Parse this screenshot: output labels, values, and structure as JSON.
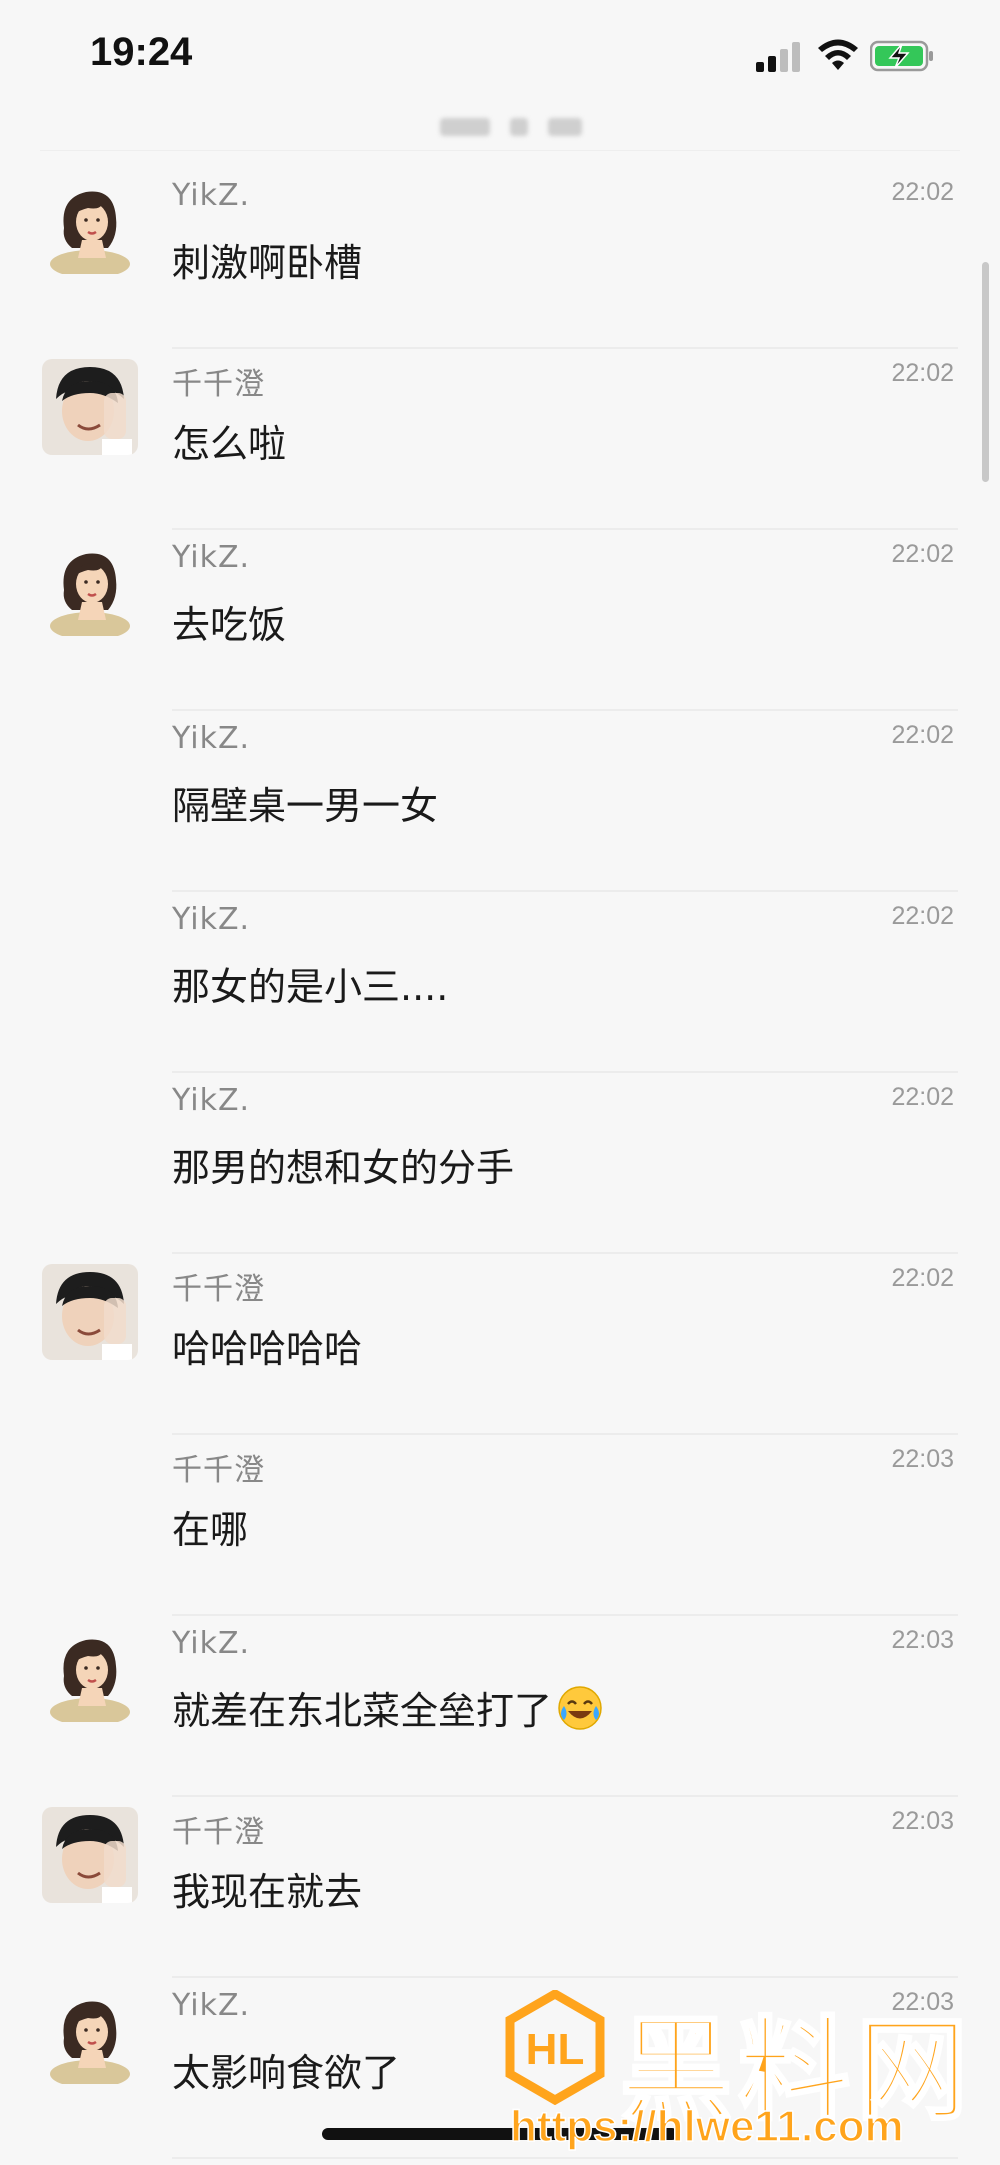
{
  "status_bar": {
    "time": "19:24",
    "icons": [
      "signal-icon",
      "wifi-icon",
      "battery-charging-icon"
    ]
  },
  "messages": [
    {
      "sender": "YikZ.",
      "time": "22:02",
      "text": "刺激啊卧槽",
      "avatar": "belle"
    },
    {
      "sender": "千千澄",
      "time": "22:02",
      "text": "怎么啦",
      "avatar": "guy"
    },
    {
      "sender": "YikZ.",
      "time": "22:02",
      "text": "去吃饭",
      "avatar": "belle"
    },
    {
      "sender": "YikZ.",
      "time": "22:02",
      "text": "隔壁桌一男一女",
      "avatar": ""
    },
    {
      "sender": "YikZ.",
      "time": "22:02",
      "text": "那女的是小三....",
      "avatar": ""
    },
    {
      "sender": "YikZ.",
      "time": "22:02",
      "text": "那男的想和女的分手",
      "avatar": ""
    },
    {
      "sender": "千千澄",
      "time": "22:02",
      "text": "哈哈哈哈哈",
      "avatar": "guy"
    },
    {
      "sender": "千千澄",
      "time": "22:03",
      "text": "在哪",
      "avatar": ""
    },
    {
      "sender": "YikZ.",
      "time": "22:03",
      "text": "就差在东北菜全垒打了",
      "avatar": "belle",
      "emoji": "laughing-crying-emoji-icon"
    },
    {
      "sender": "千千澄",
      "time": "22:03",
      "text": "我现在就去",
      "avatar": "guy"
    },
    {
      "sender": "YikZ.",
      "time": "22:03",
      "text": "太影响食欲了",
      "avatar": "belle"
    }
  ],
  "watermark": {
    "title": "黑料网",
    "url": "https://hlwe11.com"
  },
  "colors": {
    "background": "#f7f7f7",
    "sender": "#888888",
    "text": "#1a1a1a",
    "watermark": "#ffa41c"
  }
}
